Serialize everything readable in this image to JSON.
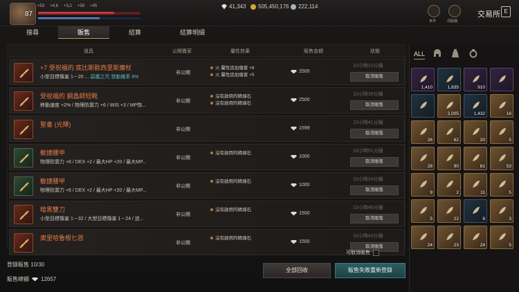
{
  "player": {
    "level": "87",
    "hp_fraction": 0.74,
    "mp_fraction": 0.6,
    "stats": [
      "+53",
      "+4,6",
      "+3,2",
      "+58",
      "+45"
    ]
  },
  "currency": [
    {
      "name": "diamond",
      "value": "41,343",
      "color": "#dfe3ea"
    },
    {
      "name": "gold",
      "value": "505,450,176",
      "color": "#d6a43a"
    },
    {
      "name": "silver",
      "value": "222,114",
      "color": "#aab0b8"
    }
  ],
  "tabs": [
    "搜尋",
    "販售",
    "結算",
    "結算明細"
  ],
  "active_tab": 1,
  "top_right": {
    "world_label": "世界",
    "server_label": "伺服器",
    "title": "交易所",
    "title_icon": "E"
  },
  "table": {
    "headers": {
      "item": "道具",
      "visibility": "公開賣家",
      "effect": "屬性效果",
      "price": "販售金額",
      "status": "狀態"
    },
    "rows": [
      {
        "name": "+7 受祝福的 底比斯歐西里斯魔杖",
        "stat": "小型目標傷害 1－20 ...",
        "stat_extra": "惡魔之咒",
        "stat_extra2": "發動機率 8%",
        "visibility": "非公開",
        "effects": [
          "火 屬性追加傷害 +6",
          "火 屬性追加傷害 +5"
        ],
        "price": "2500",
        "time": "10小時22分鐘",
        "cancel": "取消販售",
        "thumb": "red"
      },
      {
        "name": "受祝福的 鋼蠡師短靴",
        "stat": "移動速度 +2% / 物理防禦力 +6 / WIS +3 / MP恢...",
        "stat_extra": "",
        "stat_extra2": "",
        "visibility": "非公開",
        "effects": [
          "沒有啟用的精煉石",
          "沒有啟用的精煉石"
        ],
        "price": "2500",
        "time": "10小時39分鐘",
        "cancel": "取消販售",
        "thumb": "red"
      },
      {
        "name": "聖書 (光輝)",
        "stat": "",
        "stat_extra": "",
        "stat_extra2": "",
        "visibility": "非公開",
        "effects": [],
        "price": "1599",
        "time": "10小時41分鐘",
        "cancel": "取消販售",
        "thumb": "red"
      },
      {
        "name": "敏捷腰甲",
        "stat": "物理防禦力 +6 / DEX +2 / 最大HP +20 / 最大MP...",
        "stat_extra": "",
        "stat_extra2": "",
        "visibility": "非公開",
        "effects": [
          "沒有啟用的精煉石"
        ],
        "price": "1000",
        "time": "10小時51分鐘",
        "cancel": "取消販售",
        "thumb": "green"
      },
      {
        "name": "敏捷腰甲",
        "stat": "物理防禦力 +6 / DEX +2 / 最大HP +20 / 最大MP...",
        "stat_extra": "",
        "stat_extra2": "",
        "visibility": "非公開",
        "effects": [
          "沒有啟用的精煉石"
        ],
        "price": "1000",
        "time": "10小時34分鐘",
        "cancel": "取消販售",
        "thumb": "green"
      },
      {
        "name": "暗黑雙刀",
        "stat": "小型目標傷害 1－32 / 大型目標傷害 1－24 / 追...",
        "stat_extra": "",
        "stat_extra2": "",
        "visibility": "非公開",
        "effects": [
          "沒有啟用的精煉石"
        ],
        "price": "1500",
        "time": "10小時46分鐘",
        "cancel": "取消販售",
        "thumb": "red"
      },
      {
        "name": "奧里哈魯根匕首",
        "stat": "",
        "stat_extra": "",
        "stat_extra2": "",
        "visibility": "非公開",
        "effects": [
          "沒有啟用的精煉石"
        ],
        "price": "1500",
        "time": "10小時43分鐘",
        "cancel": "取消販售",
        "thumb": "red"
      }
    ]
  },
  "footer": {
    "cancelable_label": "可取消販售",
    "registered_label": "登錄販售",
    "registered_value": "10/30",
    "total_label": "販售總額",
    "total_value": "12657",
    "reclaim_all": "全部回收",
    "reregister_failed": "販售失敗重新登錄"
  },
  "inventory": {
    "tabs": [
      "ALL",
      "helmet-icon",
      "bag-icon",
      "ring-icon"
    ],
    "cells": [
      {
        "count": "1,410",
        "kind": "purple"
      },
      {
        "count": "1,835",
        "kind": "blue"
      },
      {
        "count": "910",
        "kind": "purple"
      },
      {
        "count": "",
        "kind": "purple"
      },
      {
        "count": "",
        "kind": "blue"
      },
      {
        "count": "2,005",
        "kind": "gold"
      },
      {
        "count": "1,432",
        "kind": "blue"
      },
      {
        "count": "18",
        "kind": "gold"
      },
      {
        "count": "26",
        "kind": "gold"
      },
      {
        "count": "62",
        "kind": "gold"
      },
      {
        "count": "20",
        "kind": "gold"
      },
      {
        "count": "5",
        "kind": "gold"
      },
      {
        "count": "28",
        "kind": "gold"
      },
      {
        "count": "90",
        "kind": "gold"
      },
      {
        "count": "81",
        "kind": "gold"
      },
      {
        "count": "53",
        "kind": "gold"
      },
      {
        "count": "9",
        "kind": "gold"
      },
      {
        "count": "2",
        "kind": "gold"
      },
      {
        "count": "11",
        "kind": "gold"
      },
      {
        "count": "5",
        "kind": "gold"
      },
      {
        "count": "5",
        "kind": "gold"
      },
      {
        "count": "22",
        "kind": "gold"
      },
      {
        "count": "8",
        "kind": "blue"
      },
      {
        "count": "3",
        "kind": "gold"
      },
      {
        "count": "24",
        "kind": "gold"
      },
      {
        "count": "23",
        "kind": "gold"
      },
      {
        "count": "24",
        "kind": "gold"
      },
      {
        "count": "5",
        "kind": "gold"
      }
    ]
  }
}
